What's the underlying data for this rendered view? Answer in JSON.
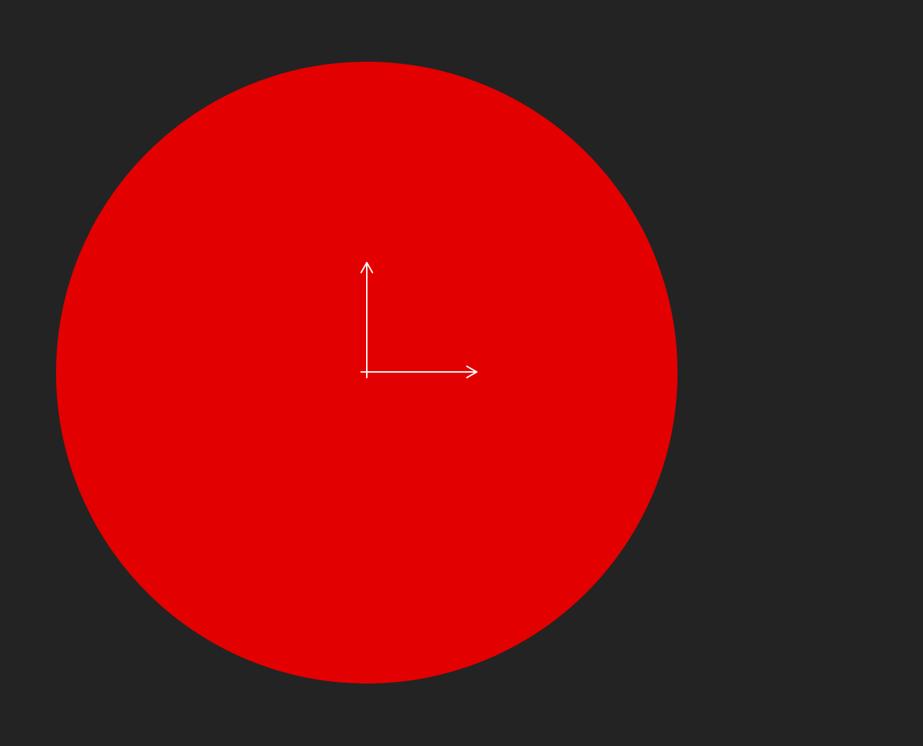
{
  "scene": {
    "background_color": "#232323",
    "shape": {
      "kind": "circle",
      "fill_color": "#e30000"
    },
    "gizmo": {
      "kind": "2d-axis-gizmo",
      "color": "#ffffff",
      "axes": [
        "x-axis-arrow",
        "y-axis-arrow"
      ]
    }
  }
}
